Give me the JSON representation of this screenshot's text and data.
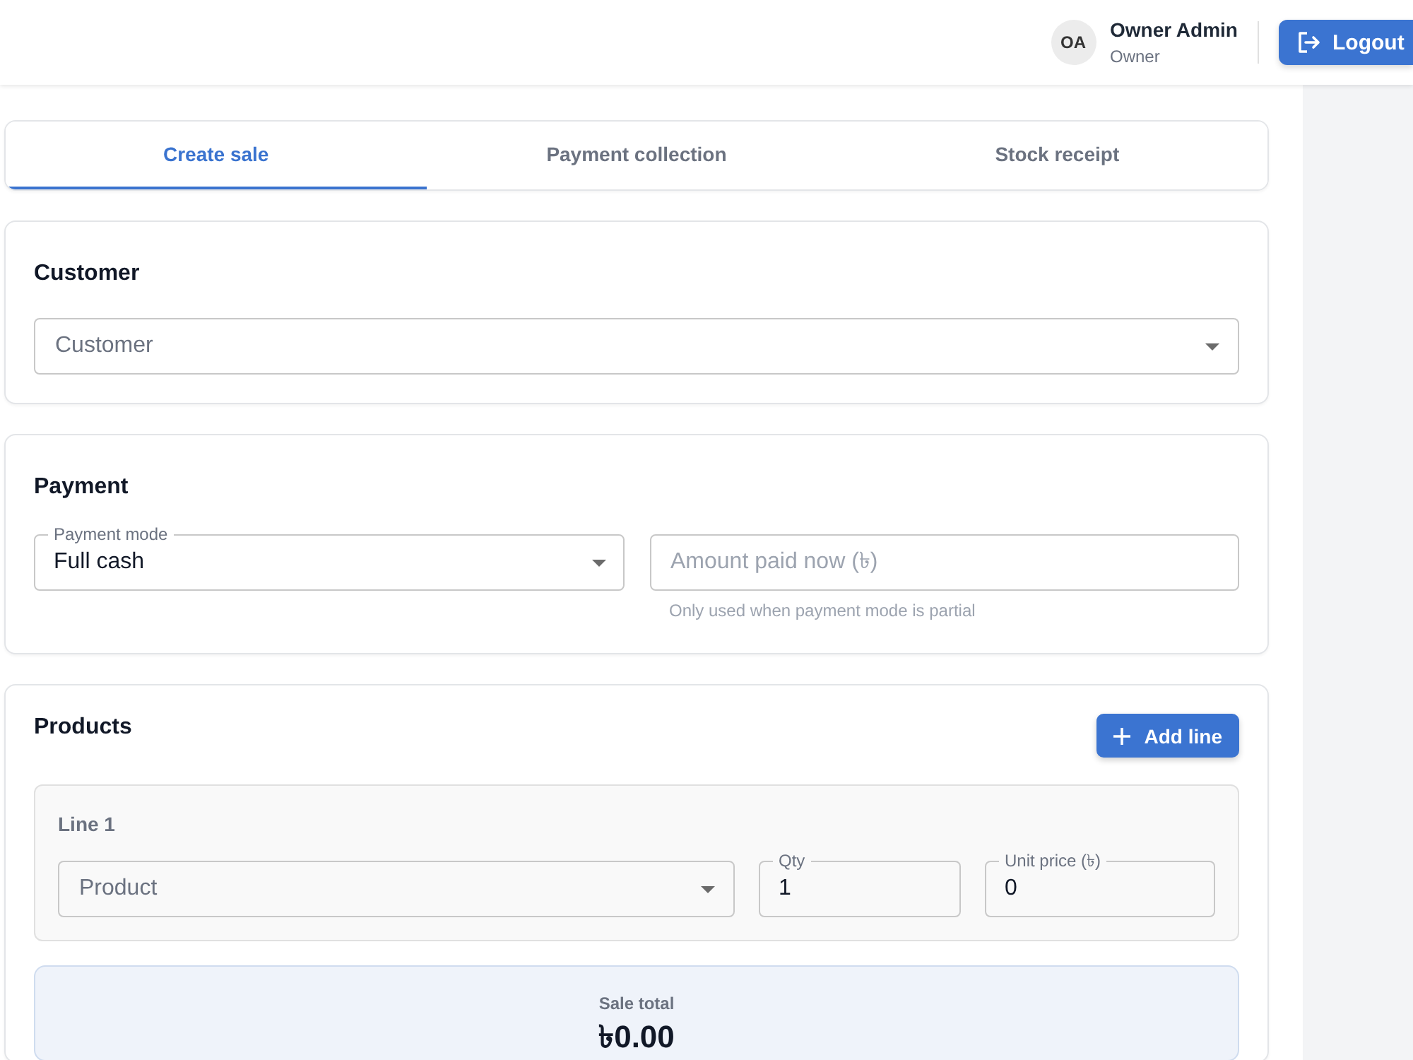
{
  "header": {
    "user": {
      "initials": "OA",
      "name": "Owner Admin",
      "role": "Owner"
    },
    "logout_button": "Logout"
  },
  "tabs": [
    {
      "label": "Create sale",
      "selected": true
    },
    {
      "label": "Payment collection",
      "selected": false
    },
    {
      "label": "Stock receipt",
      "selected": false
    }
  ],
  "customer_section": {
    "title": "Customer",
    "customer_field": {
      "placeholder": "Customer"
    }
  },
  "payment_section": {
    "title": "Payment",
    "payment_mode_field": {
      "label": "Payment mode",
      "value": "Full cash"
    },
    "amount_field": {
      "placeholder": "Amount paid now (৳)",
      "helper": "Only used when payment mode is partial"
    }
  },
  "products_section": {
    "title": "Products",
    "add_button": "Add line",
    "lines": [
      {
        "title": "Line 1",
        "product_field": {
          "placeholder": "Product"
        },
        "qty_field": {
          "label": "Qty",
          "value": "1"
        },
        "unit_price_field": {
          "label": "Unit price (৳)",
          "value": "0"
        }
      }
    ],
    "total": {
      "label": "Sale total",
      "amount": "৳0.00"
    }
  }
}
